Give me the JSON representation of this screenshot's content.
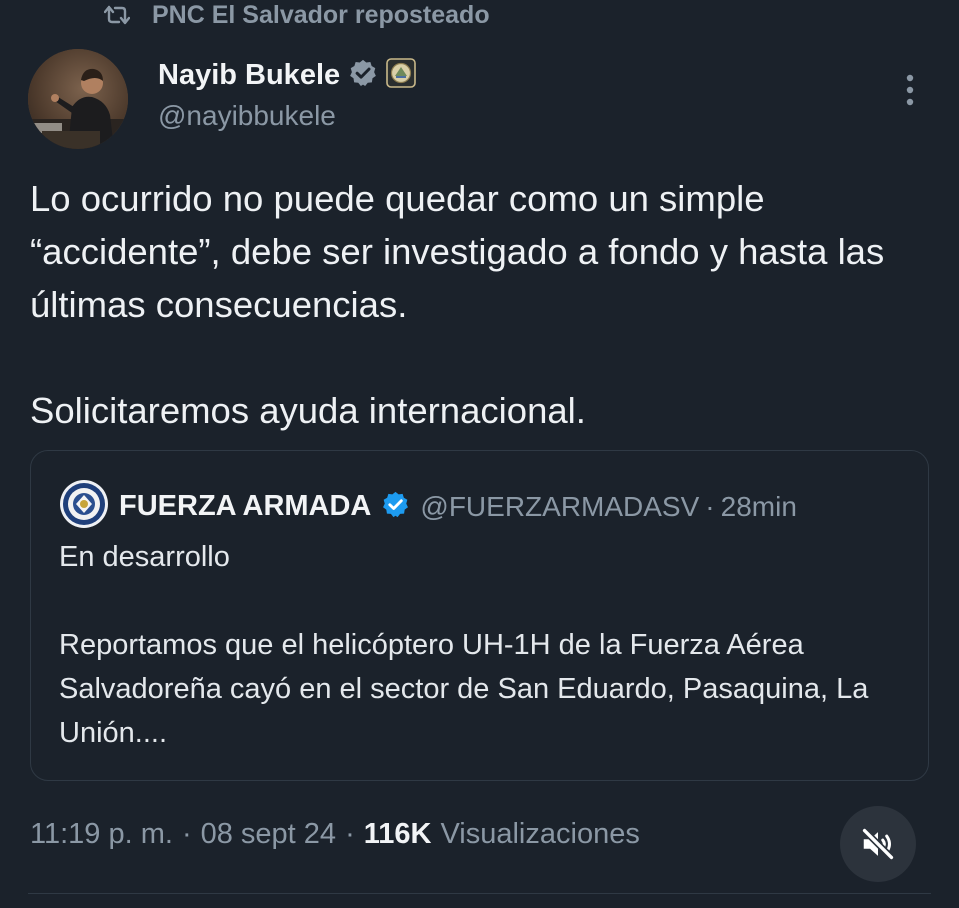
{
  "repost": {
    "icon": "repost-icon",
    "text": "PNC El Salvador reposteado"
  },
  "tweet": {
    "author_name": "Nayib Bukele",
    "handle": "@nayibbukele",
    "verified_icon": "verified-badge-gray-icon",
    "affiliation_icon": "government-seal-icon",
    "more_icon": "more-vertical-icon",
    "paragraphs": [
      "Lo ocurrido no puede quedar como un simple “accidente”, debe ser investigado a fondo y hasta las últimas consecuencias.",
      "Solicitaremos ayuda internacional."
    ]
  },
  "quote": {
    "author_name": "FUERZA ARMADA",
    "handle": "@FUERZARMADASV",
    "separator": "·",
    "time": "28min",
    "verified_icon": "verified-badge-blue-icon",
    "paragraphs": [
      "En desarrollo",
      "Reportamos que el helicóptero UH-1H de la Fuerza Aérea Salvadoreña cayó en el sector de San Eduardo, Pasaquina, La Unión...."
    ]
  },
  "meta": {
    "time": "11:19 p. m.",
    "sep1": "·",
    "date": "08 sept 24",
    "sep2": "·",
    "views_count": "116K",
    "views_label": "Visualizaciones"
  },
  "mute_button": {
    "icon": "volume-muted-icon"
  },
  "colors": {
    "background": "#1b222b",
    "primary_text": "#eef1f4",
    "secondary_text": "#8b98a5",
    "border": "#2f3944",
    "verified_blue": "#1d9bf0",
    "verified_gray": "#8b98a5"
  }
}
